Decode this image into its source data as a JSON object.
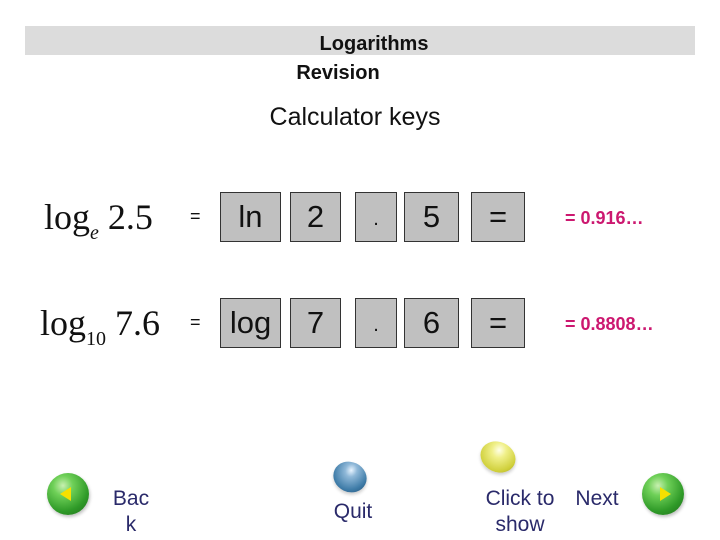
{
  "header": {
    "title_line1": "Logarithms",
    "title_line2": "Revision"
  },
  "subtitle": "Calculator keys",
  "rows": [
    {
      "expression": {
        "base_text": "log",
        "subscript": "e",
        "argument": "2.5"
      },
      "equals": "=",
      "keys": [
        "ln",
        "2",
        ".",
        "5",
        "="
      ],
      "result": "= 0.916…"
    },
    {
      "expression": {
        "base_text": "log",
        "subscript": "10",
        "argument": "7.6"
      },
      "equals": "=",
      "keys": [
        "log",
        "7",
        ".",
        "6",
        "="
      ],
      "result": "= 0.8808…"
    }
  ],
  "colors": {
    "result": "#cc1870",
    "nav_text": "#2a2a6a",
    "key_bg": "#c0c0c0",
    "title_bar": "#dcdcdc"
  },
  "nav": {
    "back_label": "Back",
    "back_line1": "Bac",
    "back_line2": "k",
    "quit_label": "Quit",
    "show_line1": "Click to",
    "show_line2": "show",
    "next_label": "Next",
    "icons": {
      "back": "green-ball-left-arrow-icon",
      "quit": "blue-ball-icon",
      "show": "yellow-ball-icon",
      "next": "green-ball-right-arrow-icon"
    }
  }
}
